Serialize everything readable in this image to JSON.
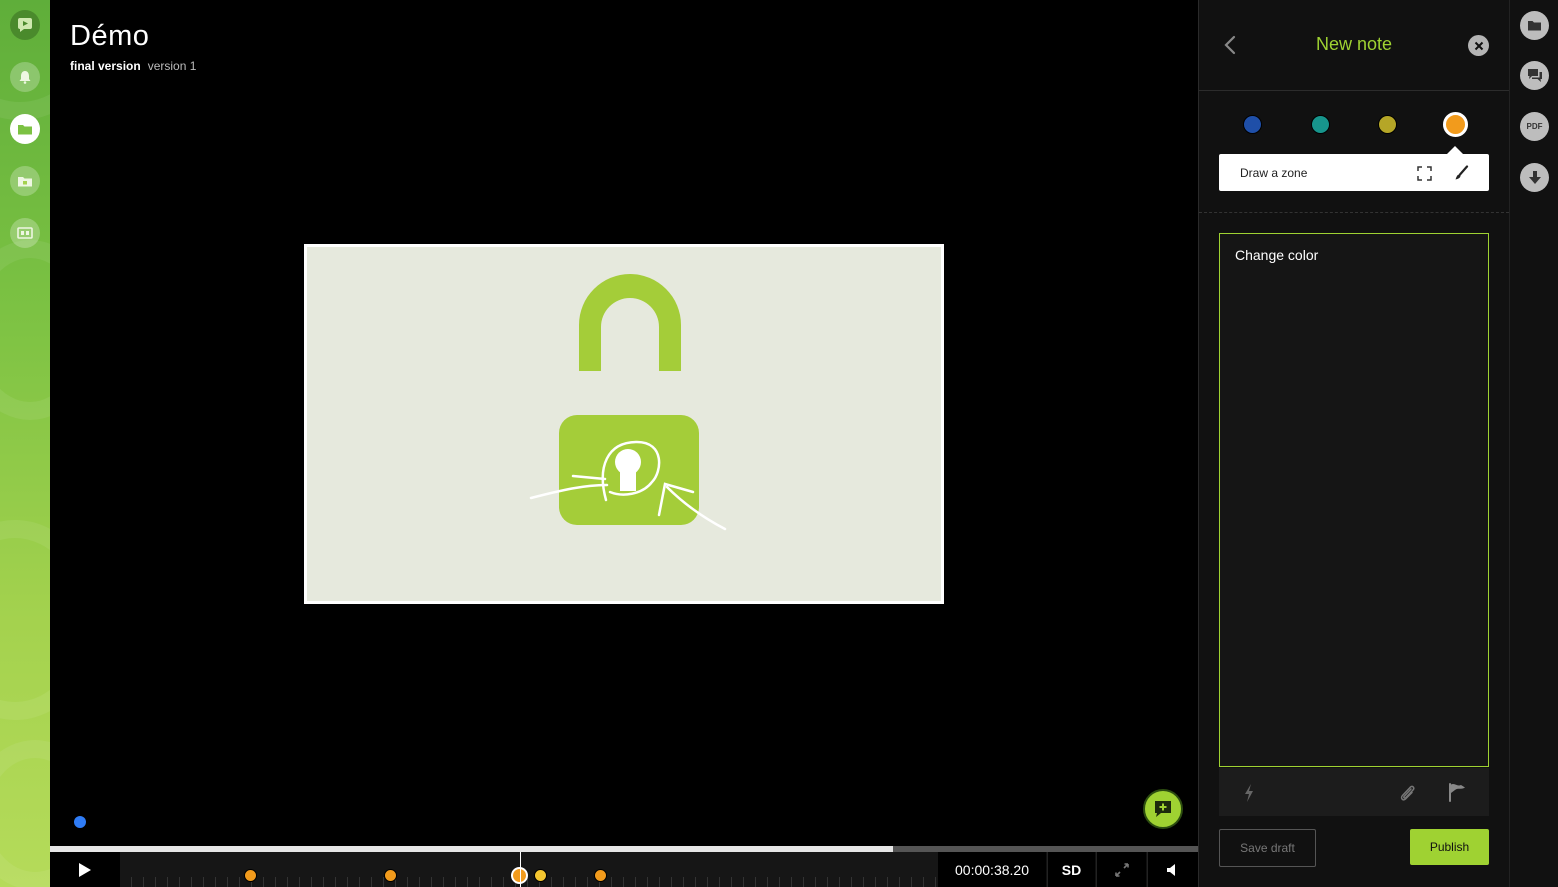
{
  "project": {
    "title": "Démo",
    "version_label": "final version",
    "version_number": "version 1"
  },
  "left_rail": {
    "icons": [
      "app-logo-icon",
      "bell-icon",
      "folder-icon",
      "calendar-folder-icon",
      "screen-icon"
    ]
  },
  "player": {
    "timecode": "00:00:38.20",
    "quality": "SD",
    "progress": 0.734,
    "markers": [
      {
        "color": "orange"
      },
      {
        "color": "orange"
      },
      {
        "color": "orange",
        "current": true
      },
      {
        "color": "yellow"
      },
      {
        "color": "orange"
      }
    ]
  },
  "note_panel": {
    "title": "New note",
    "colors": [
      {
        "name": "blue",
        "hex": "#1f4fa8"
      },
      {
        "name": "teal",
        "hex": "#17958c"
      },
      {
        "name": "olive",
        "hex": "#b5a627"
      },
      {
        "name": "orange",
        "hex": "#f29b1c",
        "selected": true
      }
    ],
    "draw_zone_label": "Draw a zone",
    "note_text": "Change color",
    "save_draft_label": "Save draft",
    "publish_label": "Publish"
  },
  "right_rail": {
    "pdf_label": "PDF"
  },
  "accent_color": "#9fd232"
}
